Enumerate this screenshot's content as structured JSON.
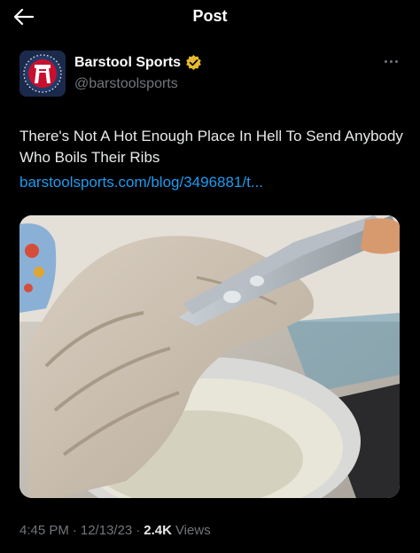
{
  "header": {
    "title": "Post"
  },
  "author": {
    "name": "Barstool Sports",
    "handle": "@barstoolsports",
    "verified": true,
    "avatar_icon": "barstool-logo-icon"
  },
  "tweet": {
    "text": "There's Not A Hot Enough Place In Hell To Send Anybody Who Boils Their Ribs",
    "link": "barstoolsports.com/blog/3496881/t..."
  },
  "meta": {
    "time": "4:45 PM",
    "date": "12/13/23",
    "views_count": "2.4K",
    "views_label": "Views"
  },
  "colors": {
    "background": "#000000",
    "link": "#1d9bf0",
    "muted": "#71767b",
    "verified_badge": "#e8b931"
  }
}
